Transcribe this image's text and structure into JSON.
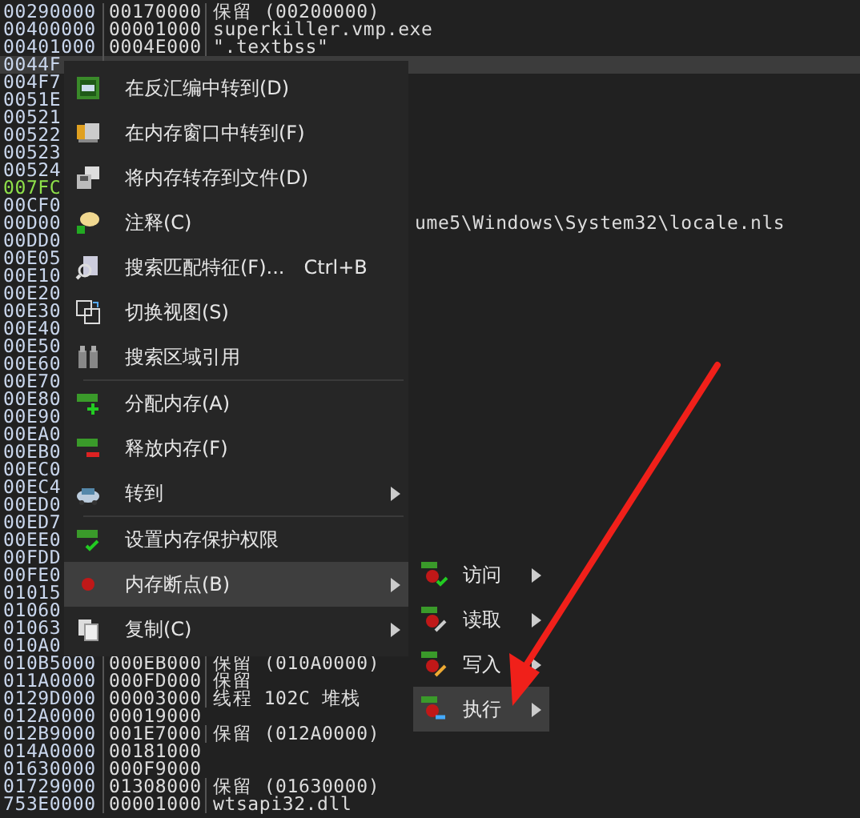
{
  "rows": [
    {
      "address": "00290000",
      "size": "00170000",
      "info": "保留 (00200000)",
      "selected": false,
      "color": "#c9d6ec"
    },
    {
      "address": "00400000",
      "size": "00001000",
      "info": "superkiller.vmp.exe",
      "selected": false,
      "color": "#c9d6ec"
    },
    {
      "address": "00401000",
      "size": "0004E000",
      "info": " \".textbss\"",
      "selected": false,
      "color": "#c9d6ec"
    },
    {
      "address": "0044F",
      "selected": true,
      "color": "#c9d6ec"
    },
    {
      "address": "004F7",
      "selected": false,
      "color": "#c9d6ec"
    },
    {
      "address": "0051E",
      "selected": false,
      "color": "#c9d6ec"
    },
    {
      "address": "00521",
      "selected": false,
      "color": "#c9d6ec"
    },
    {
      "address": "00522",
      "selected": false,
      "color": "#c9d6ec"
    },
    {
      "address": "00523",
      "selected": false,
      "color": "#c9d6ec"
    },
    {
      "address": "00524",
      "selected": false,
      "color": "#c9d6ec"
    },
    {
      "address": "007FC",
      "selected": false,
      "color": "#8ee04a"
    },
    {
      "address": "00CF0",
      "selected": false,
      "color": "#c9d6ec"
    },
    {
      "address": "00D00",
      "tail": "ume5\\Windows\\System32\\locale.nls",
      "selected": false,
      "color": "#c9d6ec"
    },
    {
      "address": "00DD0",
      "selected": false,
      "color": "#c9d6ec"
    },
    {
      "address": "00E05",
      "selected": false,
      "color": "#c9d6ec"
    },
    {
      "address": "00E10",
      "selected": false,
      "color": "#c9d6ec"
    },
    {
      "address": "00E20",
      "selected": false,
      "color": "#c9d6ec"
    },
    {
      "address": "00E30",
      "selected": false,
      "color": "#c9d6ec"
    },
    {
      "address": "00E40",
      "selected": false,
      "color": "#c9d6ec"
    },
    {
      "address": "00E50",
      "selected": false,
      "color": "#c9d6ec"
    },
    {
      "address": "00E60",
      "selected": false,
      "color": "#c9d6ec"
    },
    {
      "address": "00E70",
      "selected": false,
      "color": "#c9d6ec"
    },
    {
      "address": "00E80",
      "selected": false,
      "color": "#c9d6ec"
    },
    {
      "address": "00E90",
      "selected": false,
      "color": "#c9d6ec"
    },
    {
      "address": "00EA0",
      "selected": false,
      "color": "#c9d6ec"
    },
    {
      "address": "00EB0",
      "selected": false,
      "color": "#c9d6ec"
    },
    {
      "address": "00EC0",
      "selected": false,
      "color": "#c9d6ec"
    },
    {
      "address": "00EC4",
      "selected": false,
      "color": "#c9d6ec"
    },
    {
      "address": "00ED0",
      "selected": false,
      "color": "#c9d6ec"
    },
    {
      "address": "00ED7",
      "selected": false,
      "color": "#c9d6ec"
    },
    {
      "address": "00EE0",
      "selected": false,
      "color": "#c9d6ec"
    },
    {
      "address": "00FDD",
      "selected": false,
      "color": "#c9d6ec"
    },
    {
      "address": "00FE0",
      "selected": false,
      "color": "#c9d6ec"
    },
    {
      "address": "01015",
      "selected": false,
      "color": "#c9d6ec"
    },
    {
      "address": "01060",
      "selected": false,
      "color": "#c9d6ec"
    },
    {
      "address": "01063",
      "selected": false,
      "color": "#c9d6ec"
    },
    {
      "address": "010A0",
      "selected": false,
      "color": "#c9d6ec"
    },
    {
      "address": "010B5000",
      "size": "000EB000",
      "info": "保留 (010A0000)",
      "selected": false,
      "color": "#c9d6ec"
    },
    {
      "address": "011A0000",
      "size": "000FD000",
      "info": "保留",
      "selected": false,
      "color": "#c9d6ec"
    },
    {
      "address": "0129D000",
      "size": "00003000",
      "info": "线程 102C 堆栈",
      "selected": false,
      "color": "#c9d6ec"
    },
    {
      "address": "012A0000",
      "size": "00019000",
      "selected": false,
      "color": "#c9d6ec"
    },
    {
      "address": "012B9000",
      "size": "001E7000",
      "info": "保留 (012A0000)",
      "selected": false,
      "color": "#c9d6ec"
    },
    {
      "address": "014A0000",
      "size": "00181000",
      "selected": false,
      "color": "#c9d6ec"
    },
    {
      "address": "01630000",
      "size": "000F9000",
      "selected": false,
      "color": "#c9d6ec"
    },
    {
      "address": "01729000",
      "size": "01308000",
      "info": "保留 (01630000)",
      "selected": false,
      "color": "#c9d6ec"
    },
    {
      "address": "753E0000",
      "size": "00001000",
      "info": "wtsapi32.dll",
      "selected": false,
      "color": "#c9d6ec"
    }
  ],
  "context_menu": {
    "items": [
      {
        "kind": "item",
        "label": "在反汇编中转到(D)",
        "submenu": false,
        "selected": false
      },
      {
        "kind": "item",
        "label": "在内存窗口中转到(F)",
        "submenu": false,
        "selected": false
      },
      {
        "kind": "item",
        "label": "将内存转存到文件(D)",
        "submenu": false,
        "selected": false
      },
      {
        "kind": "item",
        "label": "注释(C)",
        "submenu": false,
        "selected": false
      },
      {
        "kind": "item",
        "label": "搜索匹配特征(F)...",
        "shortcut": "Ctrl+B",
        "submenu": false,
        "selected": false
      },
      {
        "kind": "item",
        "label": "切换视图(S)",
        "submenu": false,
        "selected": false
      },
      {
        "kind": "item",
        "label": "搜索区域引用",
        "submenu": false,
        "selected": false
      },
      {
        "kind": "separator"
      },
      {
        "kind": "item",
        "label": "分配内存(A)",
        "submenu": false,
        "selected": false
      },
      {
        "kind": "item",
        "label": "释放内存(F)",
        "submenu": false,
        "selected": false
      },
      {
        "kind": "item",
        "label": "转到",
        "submenu": true,
        "selected": false
      },
      {
        "kind": "separator"
      },
      {
        "kind": "item",
        "label": "设置内存保护权限",
        "submenu": false,
        "selected": false
      },
      {
        "kind": "item",
        "label": "内存断点(B)",
        "submenu": true,
        "selected": true
      },
      {
        "kind": "item",
        "label": "复制(C)",
        "submenu": true,
        "selected": false
      }
    ]
  },
  "submenu": {
    "items": [
      {
        "label": "访问",
        "submenu": true,
        "selected": false
      },
      {
        "label": "读取",
        "submenu": true,
        "selected": false
      },
      {
        "label": "写入",
        "submenu": true,
        "selected": false
      },
      {
        "label": "执行",
        "submenu": true,
        "selected": true
      }
    ]
  }
}
